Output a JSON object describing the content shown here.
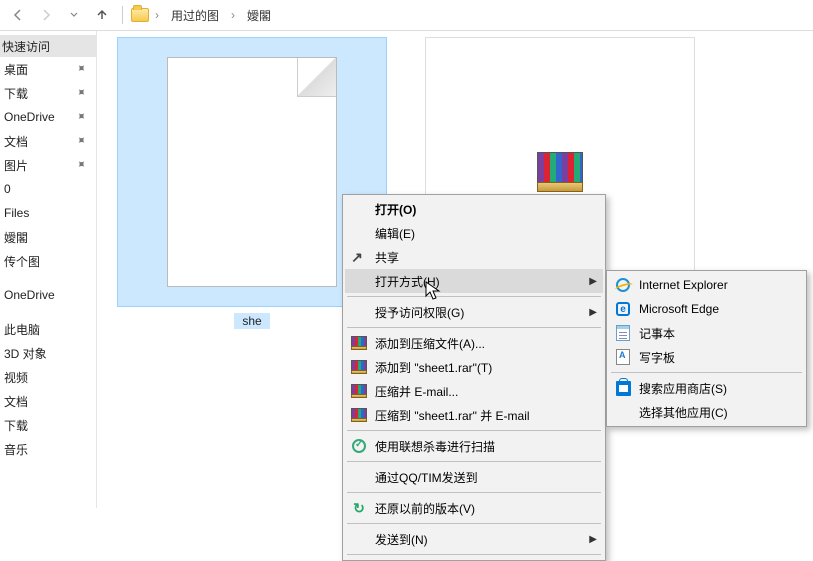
{
  "breadcrumb": {
    "seg1": "用过的图",
    "seg2": "嬡閣"
  },
  "sidebar": {
    "header": "快速访问",
    "items": [
      {
        "label": "桌面",
        "pinned": true
      },
      {
        "label": "下载",
        "pinned": true
      },
      {
        "label": "OneDrive",
        "pinned": true
      },
      {
        "label": "文档",
        "pinned": true
      },
      {
        "label": "图片",
        "pinned": true
      },
      {
        "label": "0",
        "pinned": false
      },
      {
        "label": "Files",
        "pinned": false
      },
      {
        "label": "嬡閣",
        "pinned": false
      },
      {
        "label": "传个图",
        "pinned": false
      }
    ],
    "groups": [
      "OneDrive",
      "此电脑",
      "3D 对象",
      "视频",
      "文档",
      "下载",
      "音乐"
    ]
  },
  "files": {
    "item1_caption": "she",
    "item2_caption": ""
  },
  "context_menu": {
    "open": "打开(O)",
    "edit": "编辑(E)",
    "share": "共享",
    "open_with": "打开方式(H)",
    "grant_access": "授予访问权限(G)",
    "add_archive": "添加到压缩文件(A)...",
    "add_to_rar": "添加到 \"sheet1.rar\"(T)",
    "compress_email": "压缩并 E-mail...",
    "compress_rar_email": "压缩到 \"sheet1.rar\" 并 E-mail",
    "lenovo_scan": "使用联想杀毒进行扫描",
    "send_qq": "通过QQ/TIM发送到",
    "restore_prev": "还原以前的版本(V)",
    "send_to": "发送到(N)"
  },
  "open_with_menu": {
    "ie": "Internet Explorer",
    "edge": "Microsoft Edge",
    "notepad": "记事本",
    "wordpad": "写字板",
    "store": "搜索应用商店(S)",
    "choose": "选择其他应用(C)"
  }
}
